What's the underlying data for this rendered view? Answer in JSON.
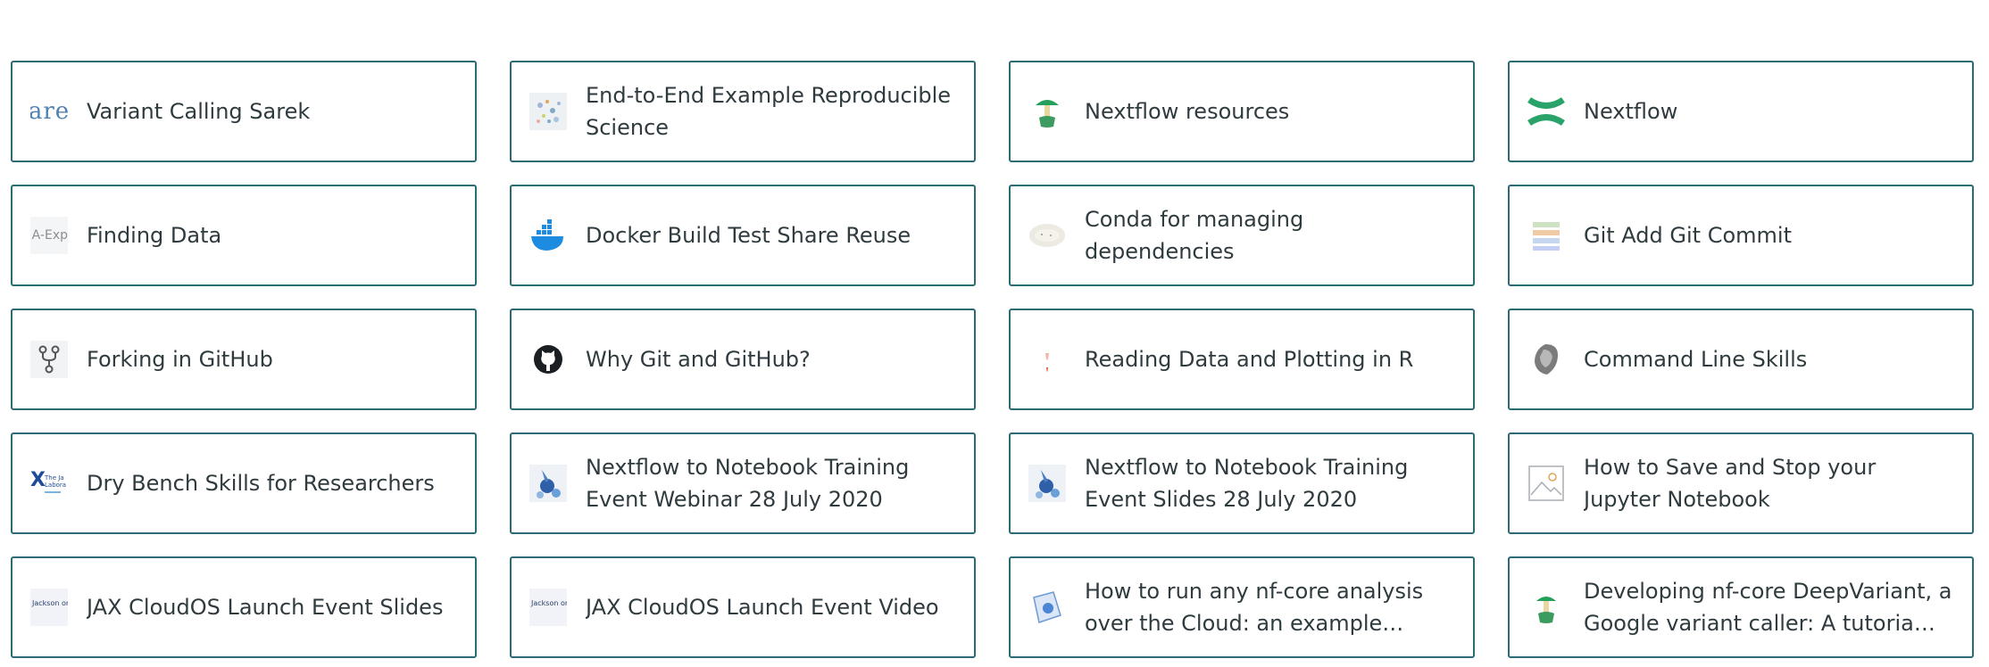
{
  "cards": [
    {
      "title": "Variant Calling Sarek",
      "icon": "sarek-logo-icon",
      "icon_text": "are"
    },
    {
      "title": "End-to-End Example Reproducible Science",
      "icon": "scatter-thumbnail-icon"
    },
    {
      "title": "Nextflow resources",
      "icon": "nf-core-apple-icon"
    },
    {
      "title": "Nextflow",
      "icon": "nextflow-logo-icon"
    },
    {
      "title": "Finding Data",
      "icon": "data-explorer-thumbnail-icon",
      "icon_text": "A-Exp"
    },
    {
      "title": "Docker Build Test Share Reuse",
      "icon": "docker-whale-icon"
    },
    {
      "title": "Conda for managing dependencies",
      "icon": "conda-thumbnail-icon"
    },
    {
      "title": "Git Add Git Commit",
      "icon": "git-diagram-icon"
    },
    {
      "title": "Forking in GitHub",
      "icon": "git-fork-icon"
    },
    {
      "title": "Why Git and GitHub?",
      "icon": "github-octocat-icon"
    },
    {
      "title": "Reading Data and Plotting in R",
      "icon": "r-plot-thumbnail-icon"
    },
    {
      "title": "Command Line Skills",
      "icon": "command-line-thumbnail-icon"
    },
    {
      "title": "Dry Bench Skills for Researchers",
      "icon": "jax-logo-icon",
      "icon_text": "The Ja Labora"
    },
    {
      "title": "Nextflow to Notebook Training Event Webinar 28 July 2020",
      "icon": "nextflow-notebook-icon"
    },
    {
      "title": "Nextflow to Notebook Training Event Slides 28 July 2020",
      "icon": "nextflow-notebook-icon"
    },
    {
      "title": "How to Save and Stop your Jupyter Notebook",
      "icon": "image-placeholder-icon"
    },
    {
      "title": "JAX CloudOS Launch Event Slides",
      "icon": "jackson-laboratory-icon",
      "icon_text": "Jackson oratory"
    },
    {
      "title": "JAX CloudOS Launch Event Video",
      "icon": "jackson-laboratory-icon",
      "icon_text": "Jackson oratory"
    },
    {
      "title": "How to run any nf-core analysis over the Cloud: an example using…",
      "icon": "cloud-analysis-icon"
    },
    {
      "title": "Developing nf-core DeepVariant, a Google variant caller: A tutoria…",
      "icon": "nf-core-apple-icon"
    }
  ]
}
